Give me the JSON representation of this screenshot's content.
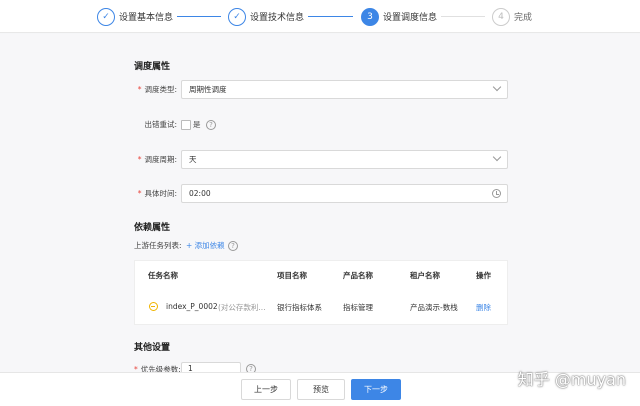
{
  "steps": [
    {
      "label": "设置基本信息",
      "state": "done",
      "icon": "check-icon"
    },
    {
      "label": "设置技术信息",
      "state": "done",
      "icon": "check-icon"
    },
    {
      "label": "设置调度信息",
      "state": "active",
      "number": "3"
    },
    {
      "label": "完成",
      "state": "pending",
      "number": "4"
    }
  ],
  "schedule": {
    "title": "调度属性",
    "type_label": "调度类型:",
    "type_value": "周期性调度",
    "retry_label": "出错重试:",
    "retry_option": "是",
    "cycle_label": "调度周期:",
    "cycle_value": "天",
    "time_label": "具体时间:",
    "time_value": "02:00"
  },
  "dependency": {
    "title": "依赖属性",
    "upstream_label": "上游任务列表:",
    "add_link": "+ 添加依赖",
    "columns": [
      "任务名称",
      "项目名称",
      "产品名称",
      "租户名称",
      "操作"
    ],
    "rows": [
      {
        "task": "index_P_0002",
        "task_note": "(对公存款利...",
        "project": "银行指标体系",
        "product": "指标管理",
        "tenant": "产品演示-数栈",
        "action": "删除"
      }
    ]
  },
  "other": {
    "title": "其他设置",
    "priority_label": "优先级参数:",
    "priority_value": "1"
  },
  "footer": {
    "prev": "上一步",
    "preview": "预览",
    "next": "下一步"
  },
  "watermark": "知乎 @muyan",
  "colors": {
    "accent": "#3d86e6",
    "required": "#e8453c",
    "warning": "#f0b400"
  }
}
